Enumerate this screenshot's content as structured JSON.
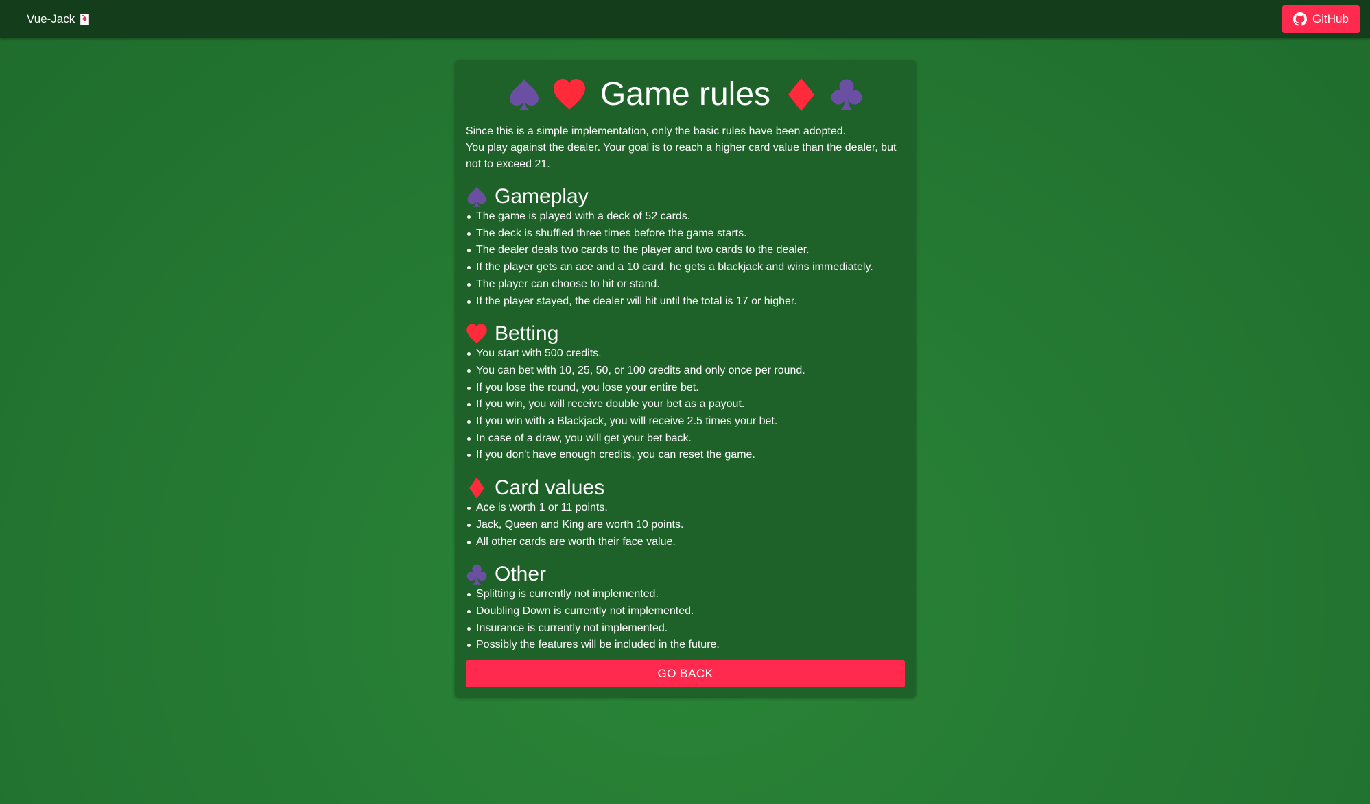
{
  "header": {
    "brand": "Vue-Jack",
    "brand_icon": "playing-card-icon",
    "github_label": "GitHub",
    "github_icon": "github-icon"
  },
  "colors": {
    "spade": "#6b4fa3",
    "heart": "#ff2a3a",
    "diamond": "#ff2a3a",
    "club": "#6b4fa3",
    "accent": "#ff2a4d",
    "topbar": "#143d1b",
    "panel": "#1e6129"
  },
  "rules_page": {
    "title": "Game rules",
    "title_icons": [
      "spade-icon",
      "heart-icon",
      "diamond-icon",
      "club-icon"
    ],
    "intro": [
      "Since this is a simple implementation, only the basic rules have been adopted.",
      "You play against the dealer. Your goal is to reach a higher card value than the dealer, but not to exceed 21."
    ],
    "sections": [
      {
        "icon": "spade-icon",
        "heading": "Gameplay",
        "items": [
          "The game is played with a deck of 52 cards.",
          "The deck is shuffled three times before the game starts.",
          "The dealer deals two cards to the player and two cards to the dealer.",
          "If the player gets an ace and a 10 card, he gets a blackjack and wins immediately.",
          "The player can choose to hit or stand.",
          "If the player stayed, the dealer will hit until the total is 17 or higher."
        ]
      },
      {
        "icon": "heart-icon",
        "heading": "Betting",
        "items": [
          "You start with 500 credits.",
          "You can bet with 10, 25, 50, or 100 credits and only once per round.",
          "If you lose the round, you lose your entire bet.",
          "If you win, you will receive double your bet as a payout.",
          "If you win with a Blackjack, you will receive 2.5 times your bet.",
          "In case of a draw, you will get your bet back.",
          "If you don't have enough credits, you can reset the game."
        ]
      },
      {
        "icon": "diamond-icon",
        "heading": "Card values",
        "items": [
          "Ace is worth 1 or 11 points.",
          "Jack, Queen and King are worth 10 points.",
          "All other cards are worth their face value."
        ]
      },
      {
        "icon": "club-icon",
        "heading": "Other",
        "items": [
          "Splitting is currently not implemented.",
          "Doubling Down is currently not implemented.",
          "Insurance is currently not implemented.",
          "Possibly the features will be included in the future."
        ]
      }
    ],
    "go_back_label": "GO BACK"
  }
}
